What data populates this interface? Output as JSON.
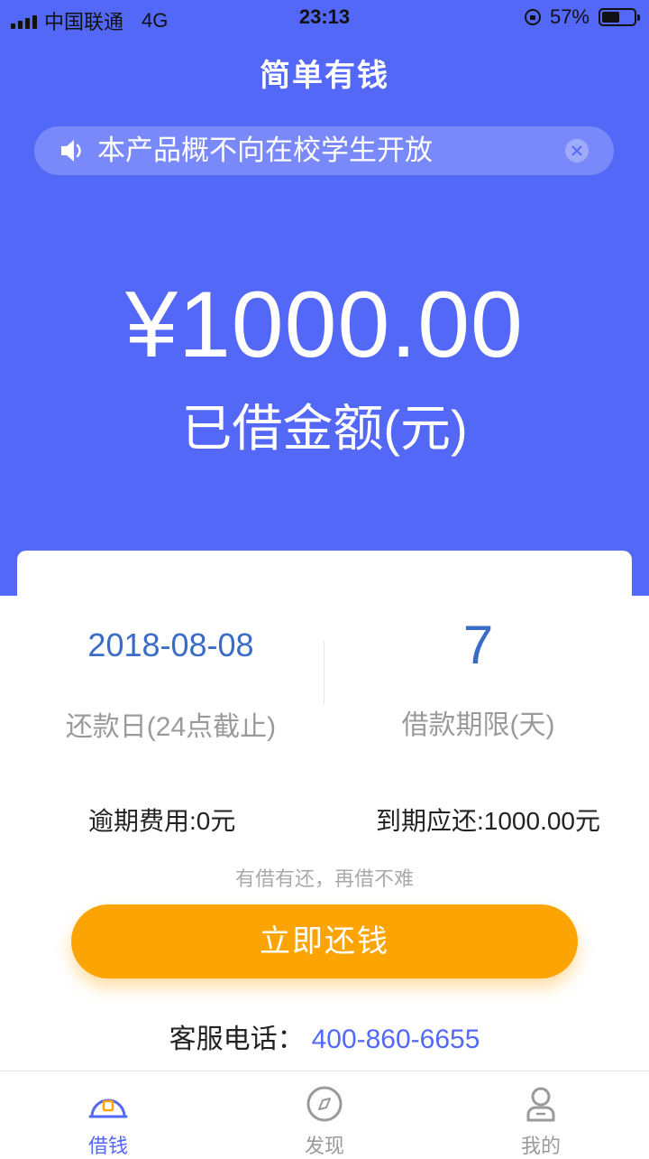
{
  "status_bar": {
    "carrier": "中国联通",
    "network": "4G",
    "time": "23:13",
    "battery": "57%",
    "battery_level": 0.57
  },
  "app_title": "简单有钱",
  "notice": {
    "text": "本产品概不向在校学生开放",
    "icon": "speaker-icon",
    "close_icon": "close-icon"
  },
  "loan": {
    "amount": "¥1000.00",
    "amount_label": "已借金额(元)"
  },
  "card": {
    "repay_date": "2018-08-08",
    "repay_date_label": "还款日(24点截止)",
    "term_days": "7",
    "term_label": "借款期限(天)",
    "overdue_fee": "逾期费用:0元",
    "due_amount": "到期应还:1000.00元",
    "slogan": "有借有还，再借不难",
    "repay_button": "立即还钱",
    "service_label": "客服电话：",
    "service_phone": "400-860-6655"
  },
  "tabs": [
    {
      "label": "借钱",
      "icon": "wallet-icon",
      "active": true
    },
    {
      "label": "发现",
      "icon": "compass-icon",
      "active": false
    },
    {
      "label": "我的",
      "icon": "user-icon",
      "active": false
    }
  ],
  "colors": {
    "primary": "#5468f8",
    "accent": "#fca403",
    "value_blue": "#3a6cc7"
  }
}
